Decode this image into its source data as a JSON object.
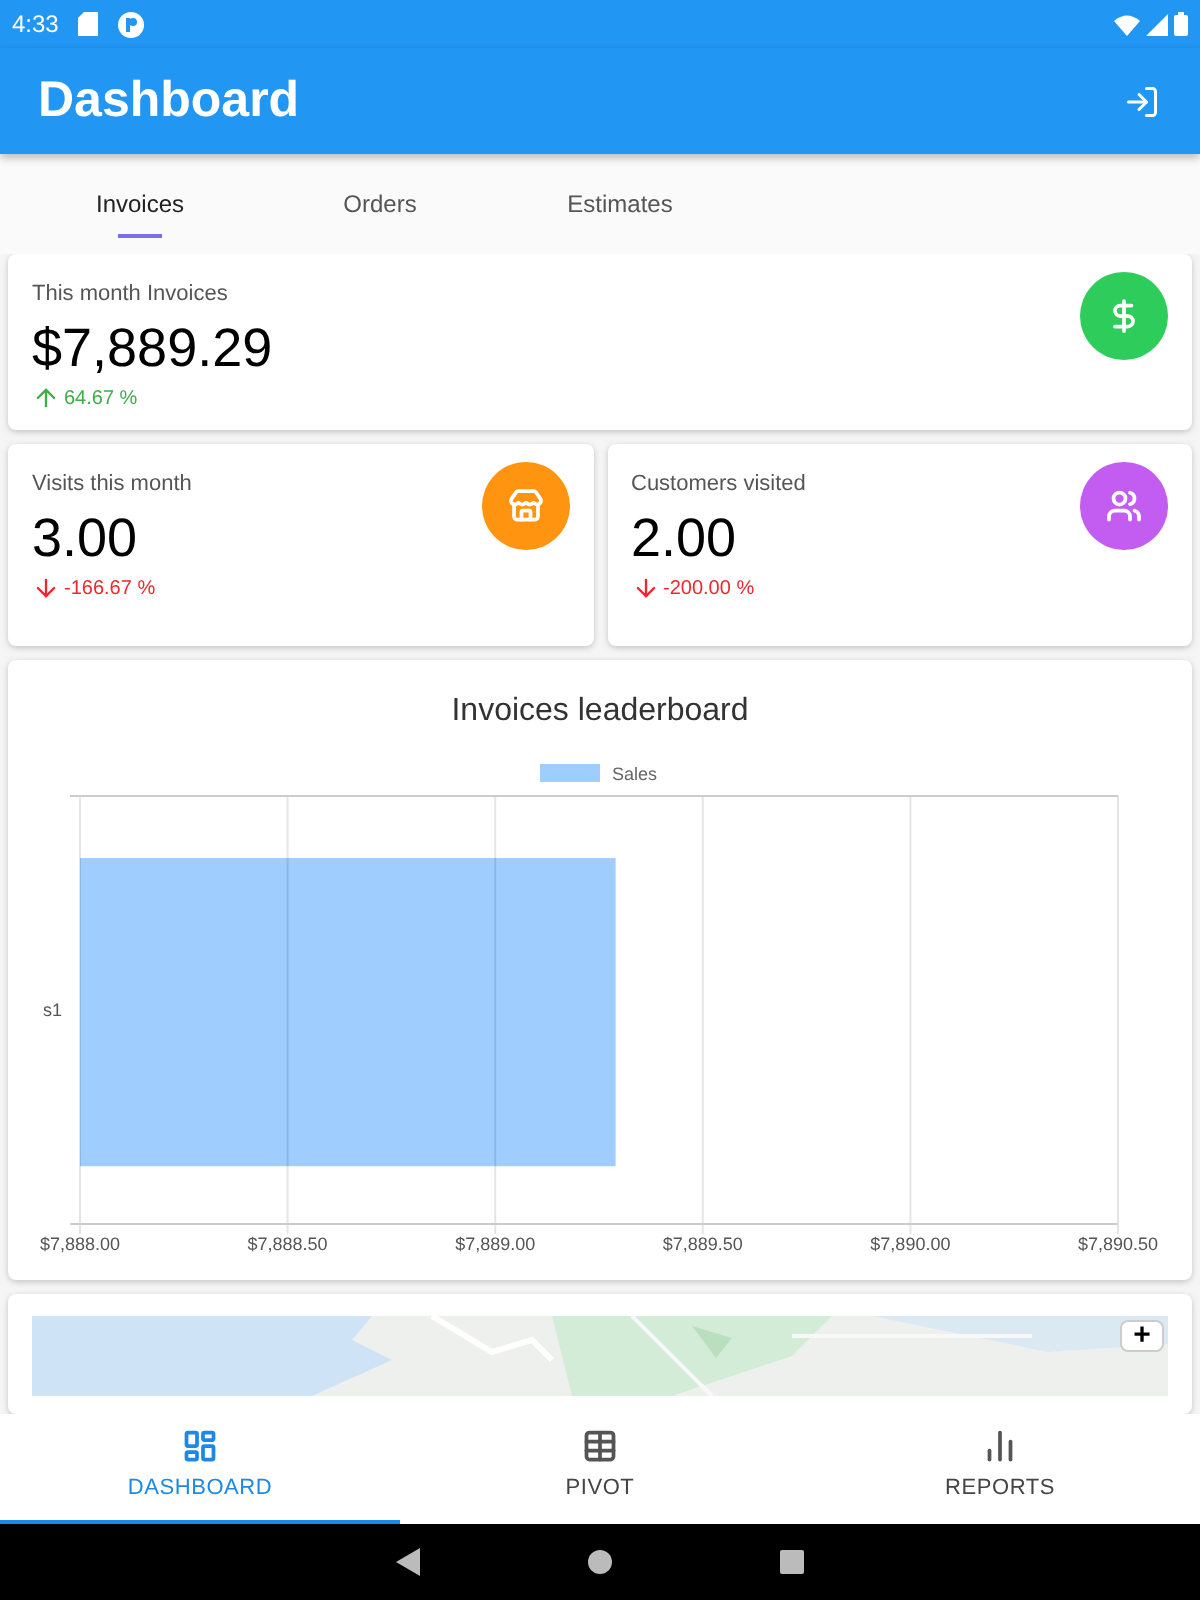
{
  "status_bar": {
    "time": "4:33"
  },
  "app_bar": {
    "title": "Dashboard"
  },
  "tabs": [
    {
      "label": "Invoices",
      "selected": true
    },
    {
      "label": "Orders",
      "selected": false
    },
    {
      "label": "Estimates",
      "selected": false
    }
  ],
  "stat_cards": [
    {
      "kind": "money",
      "title": "This month Invoices",
      "value": "$7,889.29",
      "change": {
        "text": "64.67 %",
        "kind": "up"
      },
      "color": "#2ecc5a"
    },
    {
      "kind": "store",
      "title": "Visits this month",
      "value": "3.00",
      "change": {
        "text": "-166.67 %",
        "kind": "down"
      },
      "color": "#ff9410"
    },
    {
      "kind": "people",
      "title": "Customers visited",
      "value": "2.00",
      "change": {
        "text": "-200.00 %",
        "kind": "down"
      },
      "color": "#c35cf0"
    }
  ],
  "chart_card": {
    "title": "Invoices leaderboard",
    "chart_data": {
      "type": "bar",
      "orientation": "horizontal",
      "categories": [
        "s1"
      ],
      "series": [
        {
          "name": "Sales",
          "color": "#9fcdfd",
          "values": [
            7889.29
          ]
        }
      ],
      "xlim": [
        7888,
        7890.5
      ],
      "grid": true,
      "xticks": [
        {
          "value": 7888,
          "label": "$7,888.00"
        },
        {
          "value": 7888.5,
          "label": "$7,888.50"
        },
        {
          "value": 7889,
          "label": "$7,889.00"
        },
        {
          "value": 7889.5,
          "label": "$7,889.50"
        },
        {
          "value": 7890,
          "label": "$7,890.00"
        },
        {
          "value": 7890.5,
          "label": "$7,890.50"
        }
      ]
    }
  },
  "map_card": {
    "kind": "picture",
    "zoom_button": "+"
  },
  "bottom_nav": [
    {
      "kind": "dashboard",
      "label": "DASHBOARD",
      "selected": true
    },
    {
      "kind": "pivot",
      "label": "PIVOT",
      "selected": false
    },
    {
      "kind": "reports",
      "label": "REPORTS",
      "selected": false
    }
  ]
}
